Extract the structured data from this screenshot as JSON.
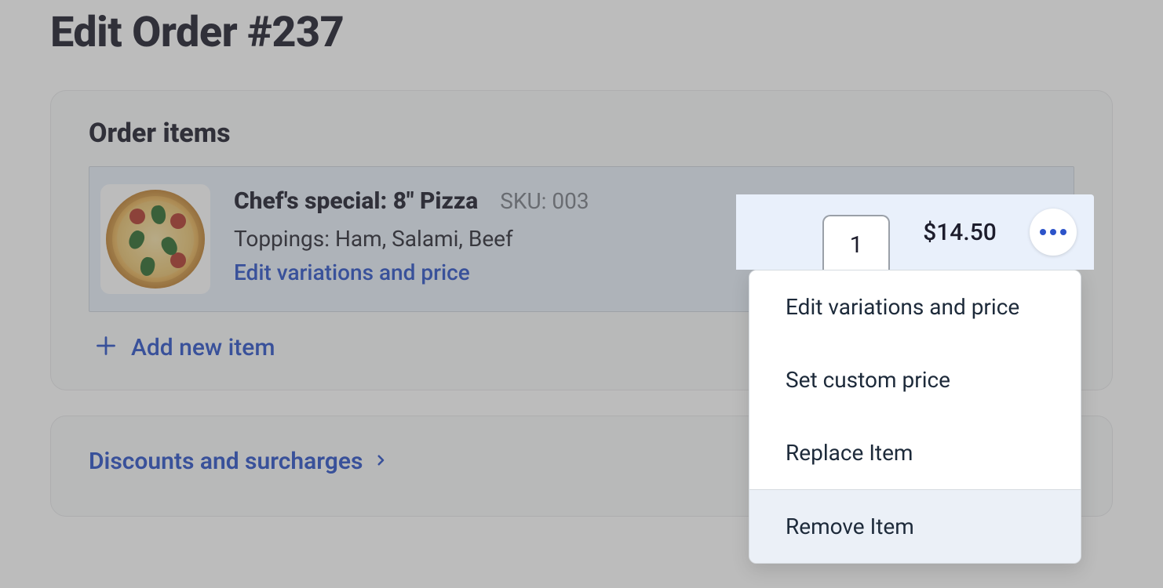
{
  "page_title": "Edit Order #237",
  "order_items": {
    "section_title": "Order items",
    "items": [
      {
        "name": "Chef's special: 8\" Pizza",
        "sku_label": "SKU: 003",
        "toppings": "Toppings: Ham, Salami, Beef",
        "edit_link": "Edit variations and price",
        "qty": "1",
        "price": "$14.50"
      }
    ],
    "add_new_label": "Add new item"
  },
  "discounts": {
    "label": "Discounts and surcharges"
  },
  "item_menu": {
    "edit": "Edit variations and price",
    "custom_price": "Set custom price",
    "replace": "Replace Item",
    "remove": "Remove Item"
  }
}
